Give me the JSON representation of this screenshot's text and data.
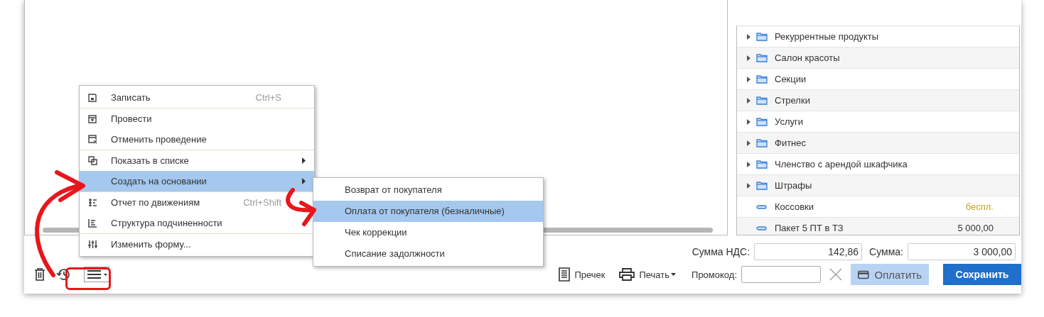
{
  "tree": {
    "rows": [
      {
        "kind": "group",
        "name": "Рекуррентные продукты"
      },
      {
        "kind": "group",
        "name": "Салон красоты"
      },
      {
        "kind": "group",
        "name": "Секции"
      },
      {
        "kind": "group",
        "name": "Стрелки"
      },
      {
        "kind": "group",
        "name": "Услуги"
      },
      {
        "kind": "group",
        "name": "Фитнес"
      },
      {
        "kind": "group",
        "name": "Членство с арендой шкафчика"
      },
      {
        "kind": "group",
        "name": "Штрафы"
      },
      {
        "kind": "item",
        "name": "Коссовки",
        "price": "беспл.",
        "color": "#c9a227"
      },
      {
        "kind": "item",
        "name": "Пакет 5 ПТ в ТЗ",
        "price": "5 000,00",
        "color": "#333333"
      }
    ]
  },
  "totals": [
    {
      "label": "Сумма НДС:",
      "value": "142,86"
    },
    {
      "label": "Сумма:",
      "value": "3 000,00"
    }
  ],
  "menu": {
    "groups": [
      [
        {
          "label": "Записать",
          "shortcut": "Ctrl+S",
          "submenu": false,
          "selected": false
        }
      ],
      [
        {
          "label": "Провести",
          "submenu": false,
          "selected": false
        },
        {
          "label": "Отменить проведение",
          "submenu": false,
          "selected": false
        }
      ],
      [
        {
          "label": "Показать в списке",
          "submenu": true,
          "selected": false
        },
        {
          "label": "Создать на основании",
          "submenu": true,
          "selected": true
        }
      ],
      [
        {
          "label": "Отчет по движениям",
          "shortcut": "Ctrl+Shift",
          "submenu": false,
          "selected": false
        },
        {
          "label": "Структура подчиненности",
          "submenu": false,
          "selected": false
        }
      ],
      [
        {
          "label": "Изменить форму...",
          "submenu": false,
          "selected": false
        }
      ]
    ]
  },
  "submenu": {
    "items": [
      {
        "label": "Возврат от покупателя",
        "selected": false
      },
      {
        "label": "Оплата от покупателя (безналичные)",
        "selected": true
      },
      {
        "label": "Чек коррекции",
        "selected": false
      },
      {
        "label": "Списание задолжности",
        "selected": false
      }
    ]
  },
  "toolbar": {
    "precheck": "Пречек",
    "print": "Печать",
    "promo_label": "Промокод:",
    "pay": {
      "label": "Оплатить",
      "disabled": true
    },
    "save": "Сохранить"
  }
}
